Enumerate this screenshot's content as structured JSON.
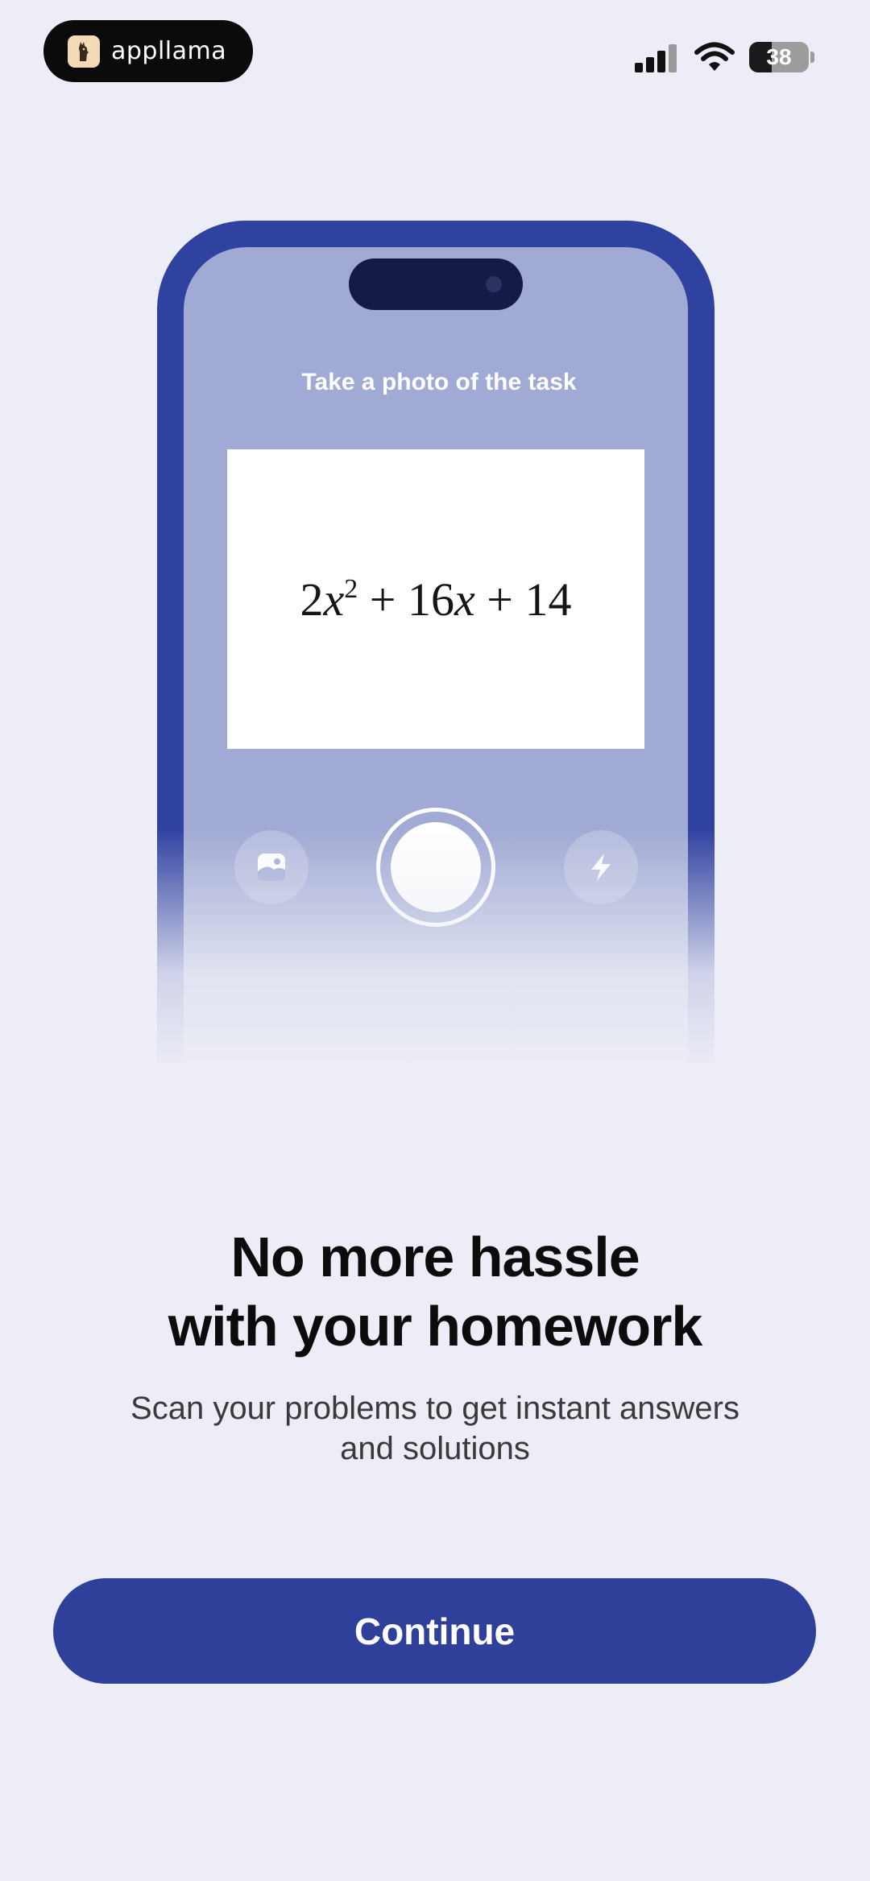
{
  "status_bar": {
    "brand_name": "appllama",
    "battery_level": "38",
    "battery_percent": 38,
    "icons": [
      "signal-icon",
      "wifi-icon",
      "battery-icon"
    ]
  },
  "illustration": {
    "prompt": "Take a photo of the task",
    "equation": {
      "coef1": "2",
      "var1": "x",
      "exp": "2",
      "op1": "+",
      "coef2": "16",
      "var2": "x",
      "op2": "+",
      "const": "14"
    },
    "buttons": [
      "gallery-icon",
      "shutter-button",
      "flash-icon"
    ]
  },
  "content": {
    "headline_line1": "No more hassle",
    "headline_line2": "with your homework",
    "subtitle_line1": "Scan your problems to get instant answers",
    "subtitle_line2": "and solutions"
  },
  "actions": {
    "continue_label": "Continue"
  },
  "colors": {
    "background": "#ecedf6",
    "accent": "#2f409a",
    "phone_frame": "#3042a0",
    "phone_screen": "#a1aad4"
  }
}
